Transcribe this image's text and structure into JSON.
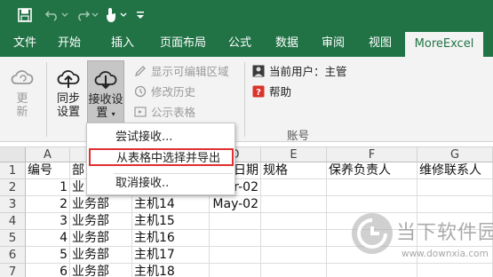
{
  "colors": {
    "brand": "#217346",
    "menu_highlight": "#e03030",
    "help_red": "#d9332a"
  },
  "qat": {
    "save_icon": "save-icon",
    "undo_icon": "undo-icon",
    "redo_icon": "redo-icon",
    "touch_icon": "touch-mode-icon",
    "customize_icon": "customize-toolbar-icon"
  },
  "tabs": [
    {
      "label": "文件"
    },
    {
      "label": "开始"
    },
    {
      "label": "插入"
    },
    {
      "label": "页面布局"
    },
    {
      "label": "公式"
    },
    {
      "label": "数据"
    },
    {
      "label": "审阅"
    },
    {
      "label": "视图"
    },
    {
      "label": "MoreExcel"
    }
  ],
  "ribbon": {
    "update": {
      "line1": "更",
      "line2": "新"
    },
    "sync": {
      "line1": "同步",
      "line2": "设置"
    },
    "receive": {
      "line1": "接收设",
      "line2": "置"
    },
    "show_editable": "显示可编辑区域",
    "history": "修改历史",
    "public_table": "公示表格",
    "current_user": "当前用户：主管",
    "help": "帮助",
    "account_group": "账号"
  },
  "menu": {
    "items": [
      {
        "label": "尝试接收..."
      },
      {
        "label": "从表格中选择并导出"
      },
      {
        "label": "取消接收.."
      }
    ]
  },
  "grid": {
    "columns": [
      "A",
      "B",
      "C",
      "D",
      "E",
      "F",
      "G"
    ],
    "rows": [
      {
        "num": "1",
        "cells": [
          "编号",
          "部",
          "",
          "日期",
          "规格",
          "保养负责人",
          "维修联系人"
        ]
      },
      {
        "num": "2",
        "cells": [
          "1",
          "业",
          "",
          "r-02",
          "",
          "",
          ""
        ]
      },
      {
        "num": "3",
        "cells": [
          "2",
          "业务部",
          "主机14",
          "May-02",
          "",
          "",
          ""
        ]
      },
      {
        "num": "4",
        "cells": [
          "3",
          "业务部",
          "主机15",
          "",
          "",
          "",
          ""
        ]
      },
      {
        "num": "5",
        "cells": [
          "4",
          "业务部",
          "主机16",
          "",
          "",
          "",
          ""
        ]
      },
      {
        "num": "6",
        "cells": [
          "5",
          "业务部",
          "主机17",
          "",
          "",
          "",
          ""
        ]
      },
      {
        "num": "7",
        "cells": [
          "6",
          "业务部",
          "主机18",
          "",
          "",
          "",
          ""
        ]
      }
    ]
  },
  "watermark": {
    "name": "当下软件园",
    "url": "www.downxia.com"
  }
}
